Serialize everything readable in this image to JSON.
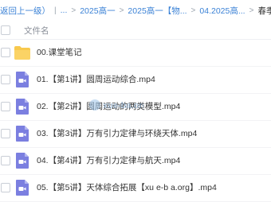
{
  "breadcrumb": {
    "items": [
      "返回上一级）",
      "...",
      "2025高一",
      "2025高一【物...",
      "04.2025高...",
      "春季班+"
    ]
  },
  "header": {
    "column_label": "文件名"
  },
  "files": [
    {
      "name": "00.课堂笔记",
      "icon": "folder-icon"
    },
    {
      "name": "01.【第1讲】圆周运动综合.mp4",
      "icon": "video-file-icon"
    },
    {
      "name": "02.【第2讲】圆周运动的两类模型.mp4",
      "icon": "video-file-icon"
    },
    {
      "name": "03.【第3讲】万有引力定律与环绕天体.mp4",
      "icon": "video-file-icon"
    },
    {
      "name": "04.【第4讲】万有引力定律与航天.mp4",
      "icon": "video-file-icon"
    },
    {
      "name": "05.【第5讲】天体综合拓展【xu e-b a.org】.mp4",
      "icon": "video-file-icon"
    }
  ],
  "watermark_text": "xue-ba.org",
  "colors": {
    "folder": "#f8c94d",
    "video": "#7b7fe0",
    "link": "#3b82d6"
  }
}
